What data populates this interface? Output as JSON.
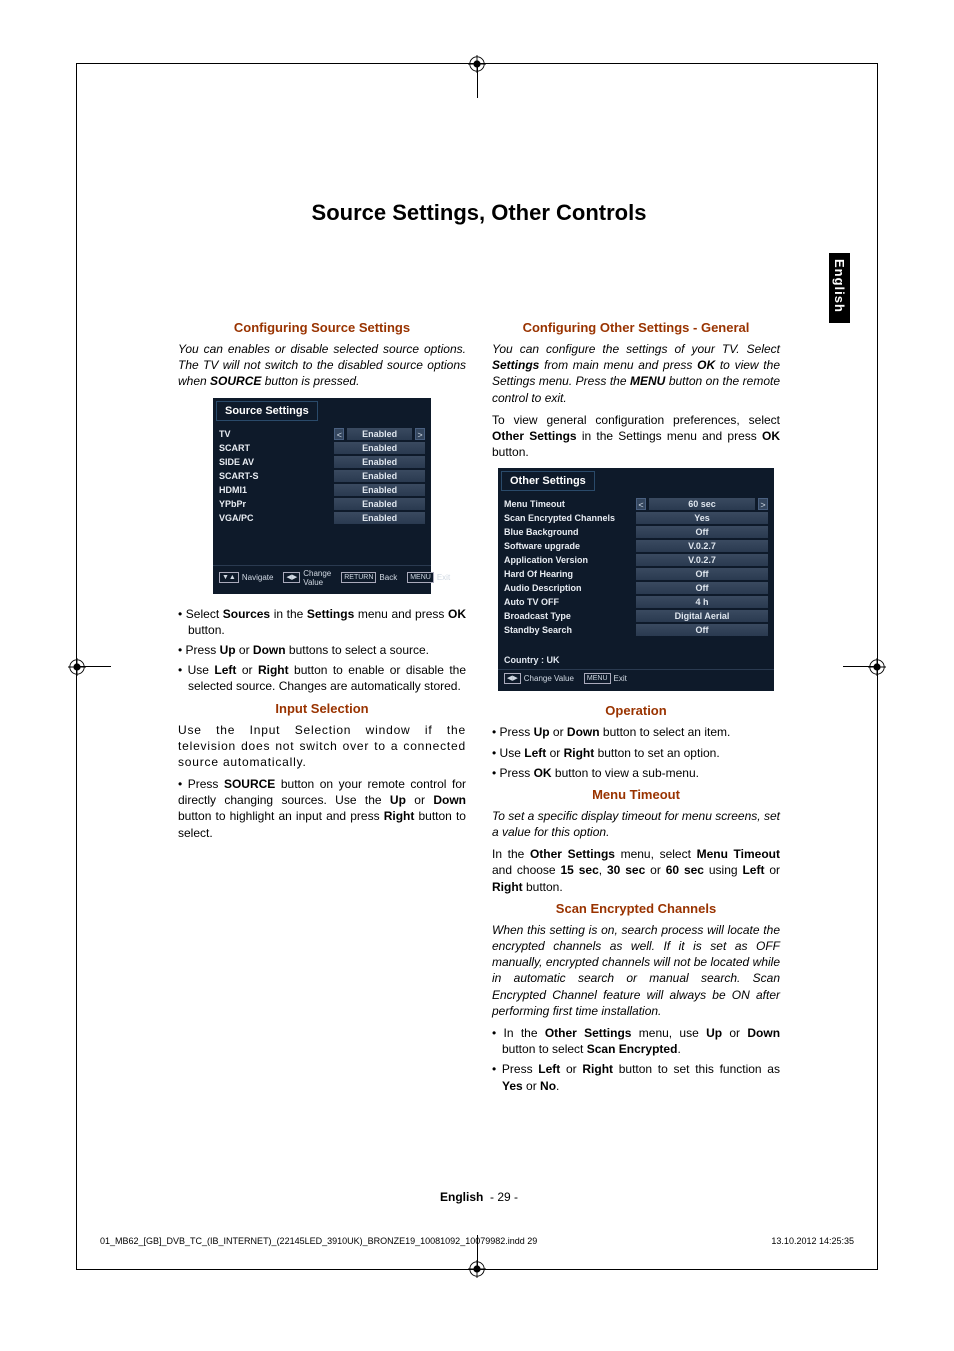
{
  "page": {
    "title": "Source Settings, Other Controls",
    "language_tab": "English",
    "page_label": "English",
    "page_number": "- 29 -",
    "footer_file": "01_MB62_[GB]_DVB_TC_(IB_INTERNET)_(22145LED_3910UK)_BRONZE19_10081092_10079982.indd   29",
    "footer_date": "13.10.2012   14:25:35"
  },
  "left": {
    "h_source": "Configuring Source Settings",
    "intro_source": "You can enables or disable selected source options. The TV will not switch to the disabled source options when SOURCE button is pressed.",
    "src_bullets": [
      "Select Sources in the Settings menu and press OK button.",
      "Press Up or Down buttons to select a source.",
      "Use Left or Right button to enable or disable the selected source. Changes are automatically stored."
    ],
    "h_input": "Input Selection",
    "input_p1": "Use the Input Selection window if the television does not switch over to a connected source automatically.",
    "input_p2": "• Press SOURCE button on your remote control for directly changing sources. Use the Up or Down button to highlight an input and press Right button to select."
  },
  "right": {
    "h_other": "Configuring Other Settings - General",
    "intro_other": "You can configure the settings of your TV. Select Settings from main menu and press OK to view the Settings menu. Press the MENU button on the remote control to exit.",
    "other_p": "To view general configuration preferences, select Other Settings in the Settings menu and press OK button.",
    "h_op": "Operation",
    "op_bullets": [
      "Press Up or Down button to select an item.",
      "Use Left or Right button to set an option.",
      "Press OK button to view a sub-menu."
    ],
    "h_timeout": "Menu Timeout",
    "timeout_i": "To set a specific display timeout for menu screens, set a value for this option.",
    "timeout_p": "In the Other Settings menu, select Menu Timeout and choose 15 sec, 30 sec or 60 sec using Left or Right button.",
    "h_scan": "Scan Encrypted Channels",
    "scan_i": "When this setting is on, search process will locate the encrypted channels as well. If it is set as OFF manually, encrypted channels will not be located while in automatic search or manual search. Scan Encrypted Channel feature will always be ON after performing first time installation.",
    "scan_bullets": [
      "In the Other Settings menu, use Up or Down button to select Scan Encrypted.",
      "Press Left or Right button to set this function as Yes or No."
    ]
  },
  "osd_source": {
    "title": "Source Settings",
    "rows": [
      {
        "label": "TV",
        "value": "Enabled",
        "active": true
      },
      {
        "label": "SCART",
        "value": "Enabled"
      },
      {
        "label": "SIDE AV",
        "value": "Enabled"
      },
      {
        "label": "SCART-S",
        "value": "Enabled"
      },
      {
        "label": "HDMI1",
        "value": "Enabled"
      },
      {
        "label": "YPbPr",
        "value": "Enabled"
      },
      {
        "label": "VGA/PC",
        "value": "Enabled"
      }
    ],
    "foot": [
      {
        "key": "▼▲",
        "label": "Navigate"
      },
      {
        "key": "◀▶",
        "label": "Change Value"
      },
      {
        "key": "RETURN",
        "label": "Back"
      },
      {
        "key": "MENU",
        "label": "Exit"
      }
    ]
  },
  "osd_other": {
    "title": "Other Settings",
    "rows": [
      {
        "label": "Menu Timeout",
        "value": "60 sec",
        "active": true
      },
      {
        "label": "Scan Encrypted Channels",
        "value": "Yes"
      },
      {
        "label": "Blue Background",
        "value": "Off"
      },
      {
        "label": "Software upgrade",
        "value": "V.0.2.7"
      },
      {
        "label": "Application Version",
        "value": "V.0.2.7"
      },
      {
        "label": "Hard Of Hearing",
        "value": "Off"
      },
      {
        "label": "Audio Description",
        "value": "Off"
      },
      {
        "label": "Auto TV OFF",
        "value": "4 h"
      },
      {
        "label": "Broadcast Type",
        "value": "Digital Aerial"
      },
      {
        "label": "Standby Search",
        "value": "Off"
      }
    ],
    "country": "Country : UK",
    "foot": [
      {
        "key": "◀▶",
        "label": "Change Value"
      },
      {
        "key": "MENU",
        "label": "Exit"
      }
    ]
  }
}
